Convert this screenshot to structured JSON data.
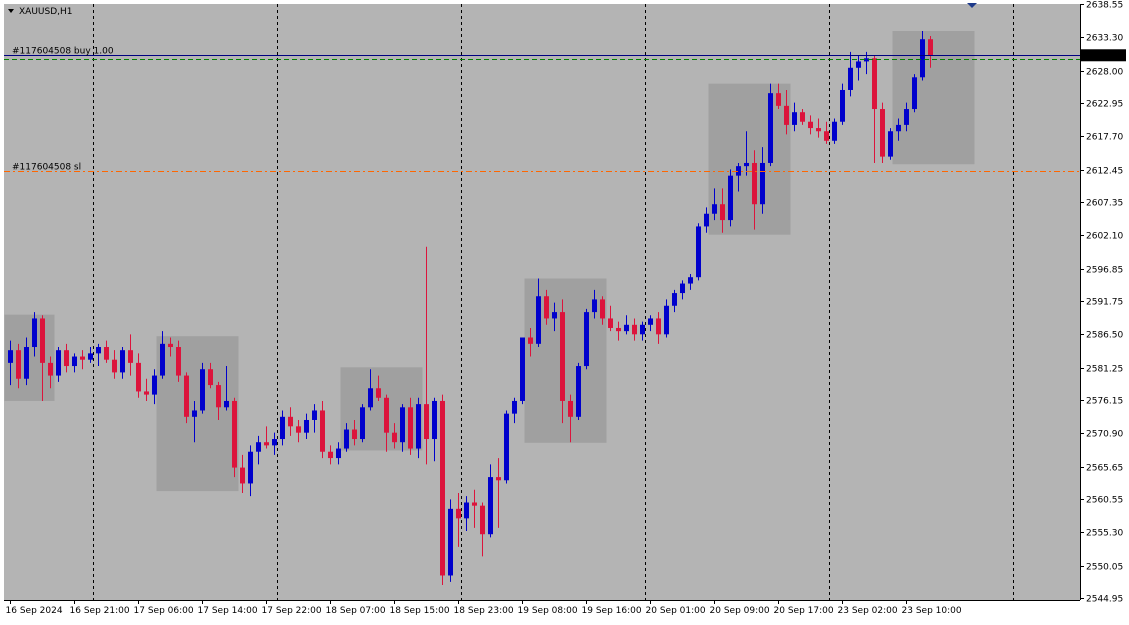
{
  "header": {
    "symbol": "XAUUSD,H1"
  },
  "chart_data": {
    "type": "candlestick",
    "symbol": "XAUUSD,H1",
    "ylim": [
      2544.95,
      2638.55
    ],
    "y_ticks": [
      2638.55,
      2633.3,
      2628.0,
      2622.95,
      2617.7,
      2612.45,
      2607.35,
      2602.1,
      2596.85,
      2591.75,
      2586.5,
      2581.25,
      2576.15,
      2570.9,
      2565.65,
      2560.55,
      2555.3,
      2550.05,
      2544.95
    ],
    "y_tick_labels": [
      "2638.55",
      "2633.30",
      "2628.00",
      "2622.95",
      "2617.70",
      "2612.45",
      "2607.35",
      "2602.10",
      "2596.85",
      "2591.75",
      "2586.50",
      "2581.25",
      "2576.15",
      "2570.90",
      "2565.65",
      "2560.55",
      "2555.30",
      "2550.05",
      "2544.95"
    ],
    "x_tick_labels": [
      "16 Sep 2024",
      "16 Sep 21:00",
      "17 Sep 06:00",
      "17 Sep 14:00",
      "17 Sep 22:00",
      "18 Sep 07:00",
      "18 Sep 15:00",
      "18 Sep 23:00",
      "19 Sep 08:00",
      "19 Sep 16:00",
      "20 Sep 01:00",
      "20 Sep 09:00",
      "20 Sep 17:00",
      "23 Sep 02:00",
      "23 Sep 10:00"
    ],
    "x_tick_bars": [
      0,
      8,
      16,
      24,
      32,
      40,
      48,
      56,
      64,
      72,
      80,
      88,
      96,
      104,
      112
    ],
    "grid": true,
    "bid": {
      "price": 2630.47,
      "label": "2630.47"
    },
    "order_lines": [
      {
        "label": "#117604508 buy 1.00",
        "price": 2630.47,
        "color": "#000080",
        "style": "solid"
      },
      {
        "label": "",
        "price": 2629.9,
        "color": "#008000",
        "style": "dashed"
      },
      {
        "label": "#117604508 sl",
        "price": 2612.3,
        "color": "#FF6600",
        "style": "dashdot"
      }
    ],
    "zones": [
      {
        "start": 0,
        "end": 5,
        "high": 2589.6,
        "low": 2576.0
      },
      {
        "start": 19,
        "end": 28,
        "high": 2586.2,
        "low": 2561.8
      },
      {
        "start": 42,
        "end": 51,
        "high": 2581.3,
        "low": 2568.2
      },
      {
        "start": 65,
        "end": 74,
        "high": 2595.3,
        "low": 2569.4
      },
      {
        "start": 88,
        "end": 97,
        "high": 2626.0,
        "low": 2602.2
      },
      {
        "start": 111,
        "end": 120,
        "high": 2634.3,
        "low": 2613.3
      }
    ],
    "colors": {
      "up": "#0000CC",
      "down": "#DC143C",
      "zone": "#A0A0A0",
      "background": "#B4B4B4",
      "grid": "#000000"
    },
    "ohlc": [
      [
        2582.0,
        2585.5,
        2578.5,
        2584.0
      ],
      [
        2584.0,
        2585.0,
        2578.0,
        2579.5
      ],
      [
        2579.5,
        2586.0,
        2578.5,
        2584.5
      ],
      [
        2584.5,
        2590.0,
        2583.0,
        2589.0
      ],
      [
        2589.0,
        2589.5,
        2576.0,
        2582.0
      ],
      [
        2582.0,
        2583.0,
        2578.0,
        2580.0
      ],
      [
        2580.0,
        2584.5,
        2579.0,
        2584.0
      ],
      [
        2584.0,
        2585.0,
        2580.5,
        2581.5
      ],
      [
        2581.5,
        2583.5,
        2580.5,
        2583.0
      ],
      [
        2583.0,
        2584.0,
        2581.0,
        2582.5
      ],
      [
        2582.5,
        2584.5,
        2582.0,
        2583.5
      ],
      [
        2583.5,
        2585.0,
        2581.5,
        2584.5
      ],
      [
        2584.5,
        2585.5,
        2582.0,
        2582.5
      ],
      [
        2582.5,
        2584.0,
        2579.5,
        2580.5
      ],
      [
        2580.5,
        2584.5,
        2579.5,
        2584.0
      ],
      [
        2584.0,
        2586.5,
        2580.0,
        2582.0
      ],
      [
        2582.0,
        2583.5,
        2576.5,
        2577.5
      ],
      [
        2577.5,
        2579.5,
        2576.0,
        2577.0
      ],
      [
        2577.0,
        2581.0,
        2575.5,
        2580.0
      ],
      [
        2580.0,
        2587.0,
        2579.5,
        2585.0
      ],
      [
        2585.0,
        2586.0,
        2583.0,
        2584.5
      ],
      [
        2584.5,
        2585.5,
        2579.0,
        2580.0
      ],
      [
        2580.0,
        2580.5,
        2572.5,
        2573.5
      ],
      [
        2573.5,
        2576.0,
        2569.5,
        2574.5
      ],
      [
        2574.5,
        2582.0,
        2574.0,
        2581.0
      ],
      [
        2581.0,
        2582.0,
        2578.0,
        2578.5
      ],
      [
        2578.5,
        2579.0,
        2573.0,
        2575.0
      ],
      [
        2575.0,
        2581.5,
        2574.5,
        2576.0
      ],
      [
        2576.0,
        2576.5,
        2564.0,
        2565.5
      ],
      [
        2565.5,
        2567.5,
        2561.5,
        2563.0
      ],
      [
        2563.0,
        2569.0,
        2561.0,
        2568.0
      ],
      [
        2568.0,
        2570.5,
        2566.0,
        2569.5
      ],
      [
        2569.5,
        2572.0,
        2568.5,
        2569.0
      ],
      [
        2569.0,
        2571.0,
        2567.5,
        2570.0
      ],
      [
        2570.0,
        2574.5,
        2569.0,
        2573.5
      ],
      [
        2573.5,
        2575.0,
        2570.5,
        2572.0
      ],
      [
        2572.0,
        2573.0,
        2569.5,
        2571.0
      ],
      [
        2571.0,
        2574.0,
        2570.0,
        2573.0
      ],
      [
        2573.0,
        2575.5,
        2571.0,
        2574.5
      ],
      [
        2574.5,
        2576.0,
        2567.0,
        2568.0
      ],
      [
        2568.0,
        2569.0,
        2566.0,
        2567.0
      ],
      [
        2567.0,
        2569.5,
        2566.0,
        2568.5
      ],
      [
        2568.5,
        2572.5,
        2568.0,
        2571.5
      ],
      [
        2571.5,
        2573.0,
        2569.0,
        2570.0
      ],
      [
        2570.0,
        2575.5,
        2569.5,
        2575.0
      ],
      [
        2575.0,
        2581.0,
        2574.5,
        2578.0
      ],
      [
        2578.0,
        2580.0,
        2576.0,
        2576.5
      ],
      [
        2576.5,
        2577.0,
        2568.0,
        2571.0
      ],
      [
        2571.0,
        2572.5,
        2568.5,
        2569.5
      ],
      [
        2569.5,
        2575.5,
        2568.0,
        2575.0
      ],
      [
        2575.0,
        2576.5,
        2567.5,
        2568.5
      ],
      [
        2568.5,
        2576.5,
        2567.0,
        2575.5
      ],
      [
        2575.5,
        2600.3,
        2566.0,
        2570.0
      ],
      [
        2570.0,
        2576.5,
        2566.5,
        2576.0
      ],
      [
        2576.0,
        2577.0,
        2547.0,
        2548.5
      ],
      [
        2548.5,
        2560.5,
        2547.5,
        2559.0
      ],
      [
        2559.0,
        2561.5,
        2553.0,
        2557.5
      ],
      [
        2557.5,
        2561.0,
        2555.5,
        2560.0
      ],
      [
        2560.0,
        2562.0,
        2556.0,
        2559.5
      ],
      [
        2559.5,
        2560.0,
        2551.5,
        2555.0
      ],
      [
        2555.0,
        2566.0,
        2554.5,
        2564.0
      ],
      [
        2564.0,
        2567.0,
        2556.0,
        2563.5
      ],
      [
        2563.5,
        2574.5,
        2563.0,
        2574.0
      ],
      [
        2574.0,
        2576.5,
        2572.5,
        2576.0
      ],
      [
        2576.0,
        2586.0,
        2575.5,
        2586.0
      ],
      [
        2586.0,
        2587.5,
        2583.0,
        2585.0
      ],
      [
        2585.0,
        2595.3,
        2584.5,
        2592.5
      ],
      [
        2592.5,
        2593.5,
        2588.0,
        2589.0
      ],
      [
        2589.0,
        2591.5,
        2587.0,
        2590.0
      ],
      [
        2590.0,
        2592.0,
        2572.5,
        2576.0
      ],
      [
        2576.0,
        2577.0,
        2569.5,
        2573.5
      ],
      [
        2573.5,
        2582.0,
        2573.0,
        2581.5
      ],
      [
        2581.5,
        2590.5,
        2581.0,
        2590.0
      ],
      [
        2590.0,
        2593.5,
        2589.0,
        2592.0
      ],
      [
        2592.0,
        2592.5,
        2588.0,
        2589.0
      ],
      [
        2589.0,
        2591.0,
        2587.0,
        2587.5
      ],
      [
        2587.5,
        2588.5,
        2585.5,
        2587.0
      ],
      [
        2587.0,
        2589.5,
        2586.5,
        2588.0
      ],
      [
        2588.0,
        2589.0,
        2585.5,
        2586.5
      ],
      [
        2586.5,
        2588.5,
        2585.5,
        2588.0
      ],
      [
        2588.0,
        2589.5,
        2587.0,
        2589.0
      ],
      [
        2589.0,
        2590.0,
        2585.0,
        2586.5
      ],
      [
        2586.5,
        2592.0,
        2586.0,
        2591.0
      ],
      [
        2591.0,
        2593.5,
        2590.0,
        2593.0
      ],
      [
        2593.0,
        2595.0,
        2592.0,
        2594.5
      ],
      [
        2594.5,
        2596.0,
        2593.5,
        2595.5
      ],
      [
        2595.5,
        2604.0,
        2595.0,
        2603.5
      ],
      [
        2603.5,
        2606.5,
        2602.5,
        2605.5
      ],
      [
        2605.5,
        2609.5,
        2604.5,
        2607.0
      ],
      [
        2607.0,
        2609.5,
        2602.5,
        2604.5
      ],
      [
        2604.5,
        2612.5,
        2603.5,
        2611.5
      ],
      [
        2611.5,
        2613.5,
        2609.0,
        2613.0
      ],
      [
        2613.0,
        2618.5,
        2611.5,
        2613.5
      ],
      [
        2613.5,
        2615.5,
        2603.0,
        2607.0
      ],
      [
        2607.0,
        2616.0,
        2605.5,
        2613.5
      ],
      [
        2613.5,
        2626.0,
        2613.0,
        2624.5
      ],
      [
        2624.5,
        2626.0,
        2622.0,
        2622.5
      ],
      [
        2622.5,
        2625.0,
        2618.0,
        2619.5
      ],
      [
        2619.5,
        2623.0,
        2618.5,
        2621.5
      ],
      [
        2621.5,
        2622.0,
        2619.5,
        2620.0
      ],
      [
        2620.0,
        2621.0,
        2618.0,
        2619.0
      ],
      [
        2619.0,
        2620.5,
        2617.5,
        2618.5
      ],
      [
        2618.5,
        2620.0,
        2616.5,
        2617.0
      ],
      [
        2617.0,
        2620.5,
        2616.5,
        2620.0
      ],
      [
        2620.0,
        2626.0,
        2619.5,
        2625.0
      ],
      [
        2625.0,
        2631.0,
        2624.0,
        2628.5
      ],
      [
        2628.5,
        2630.5,
        2626.5,
        2629.5
      ],
      [
        2629.5,
        2631.0,
        2627.5,
        2630.0
      ],
      [
        2630.0,
        2630.5,
        2613.5,
        2622.0
      ],
      [
        2622.0,
        2623.0,
        2613.5,
        2614.5
      ],
      [
        2614.5,
        2619.0,
        2614.0,
        2618.5
      ],
      [
        2618.5,
        2620.5,
        2617.0,
        2619.5
      ],
      [
        2619.5,
        2623.0,
        2618.5,
        2622.0
      ],
      [
        2622.0,
        2627.5,
        2621.5,
        2627.0
      ],
      [
        2627.0,
        2634.3,
        2626.5,
        2633.0
      ],
      [
        2633.0,
        2633.5,
        2628.5,
        2630.5
      ]
    ]
  }
}
